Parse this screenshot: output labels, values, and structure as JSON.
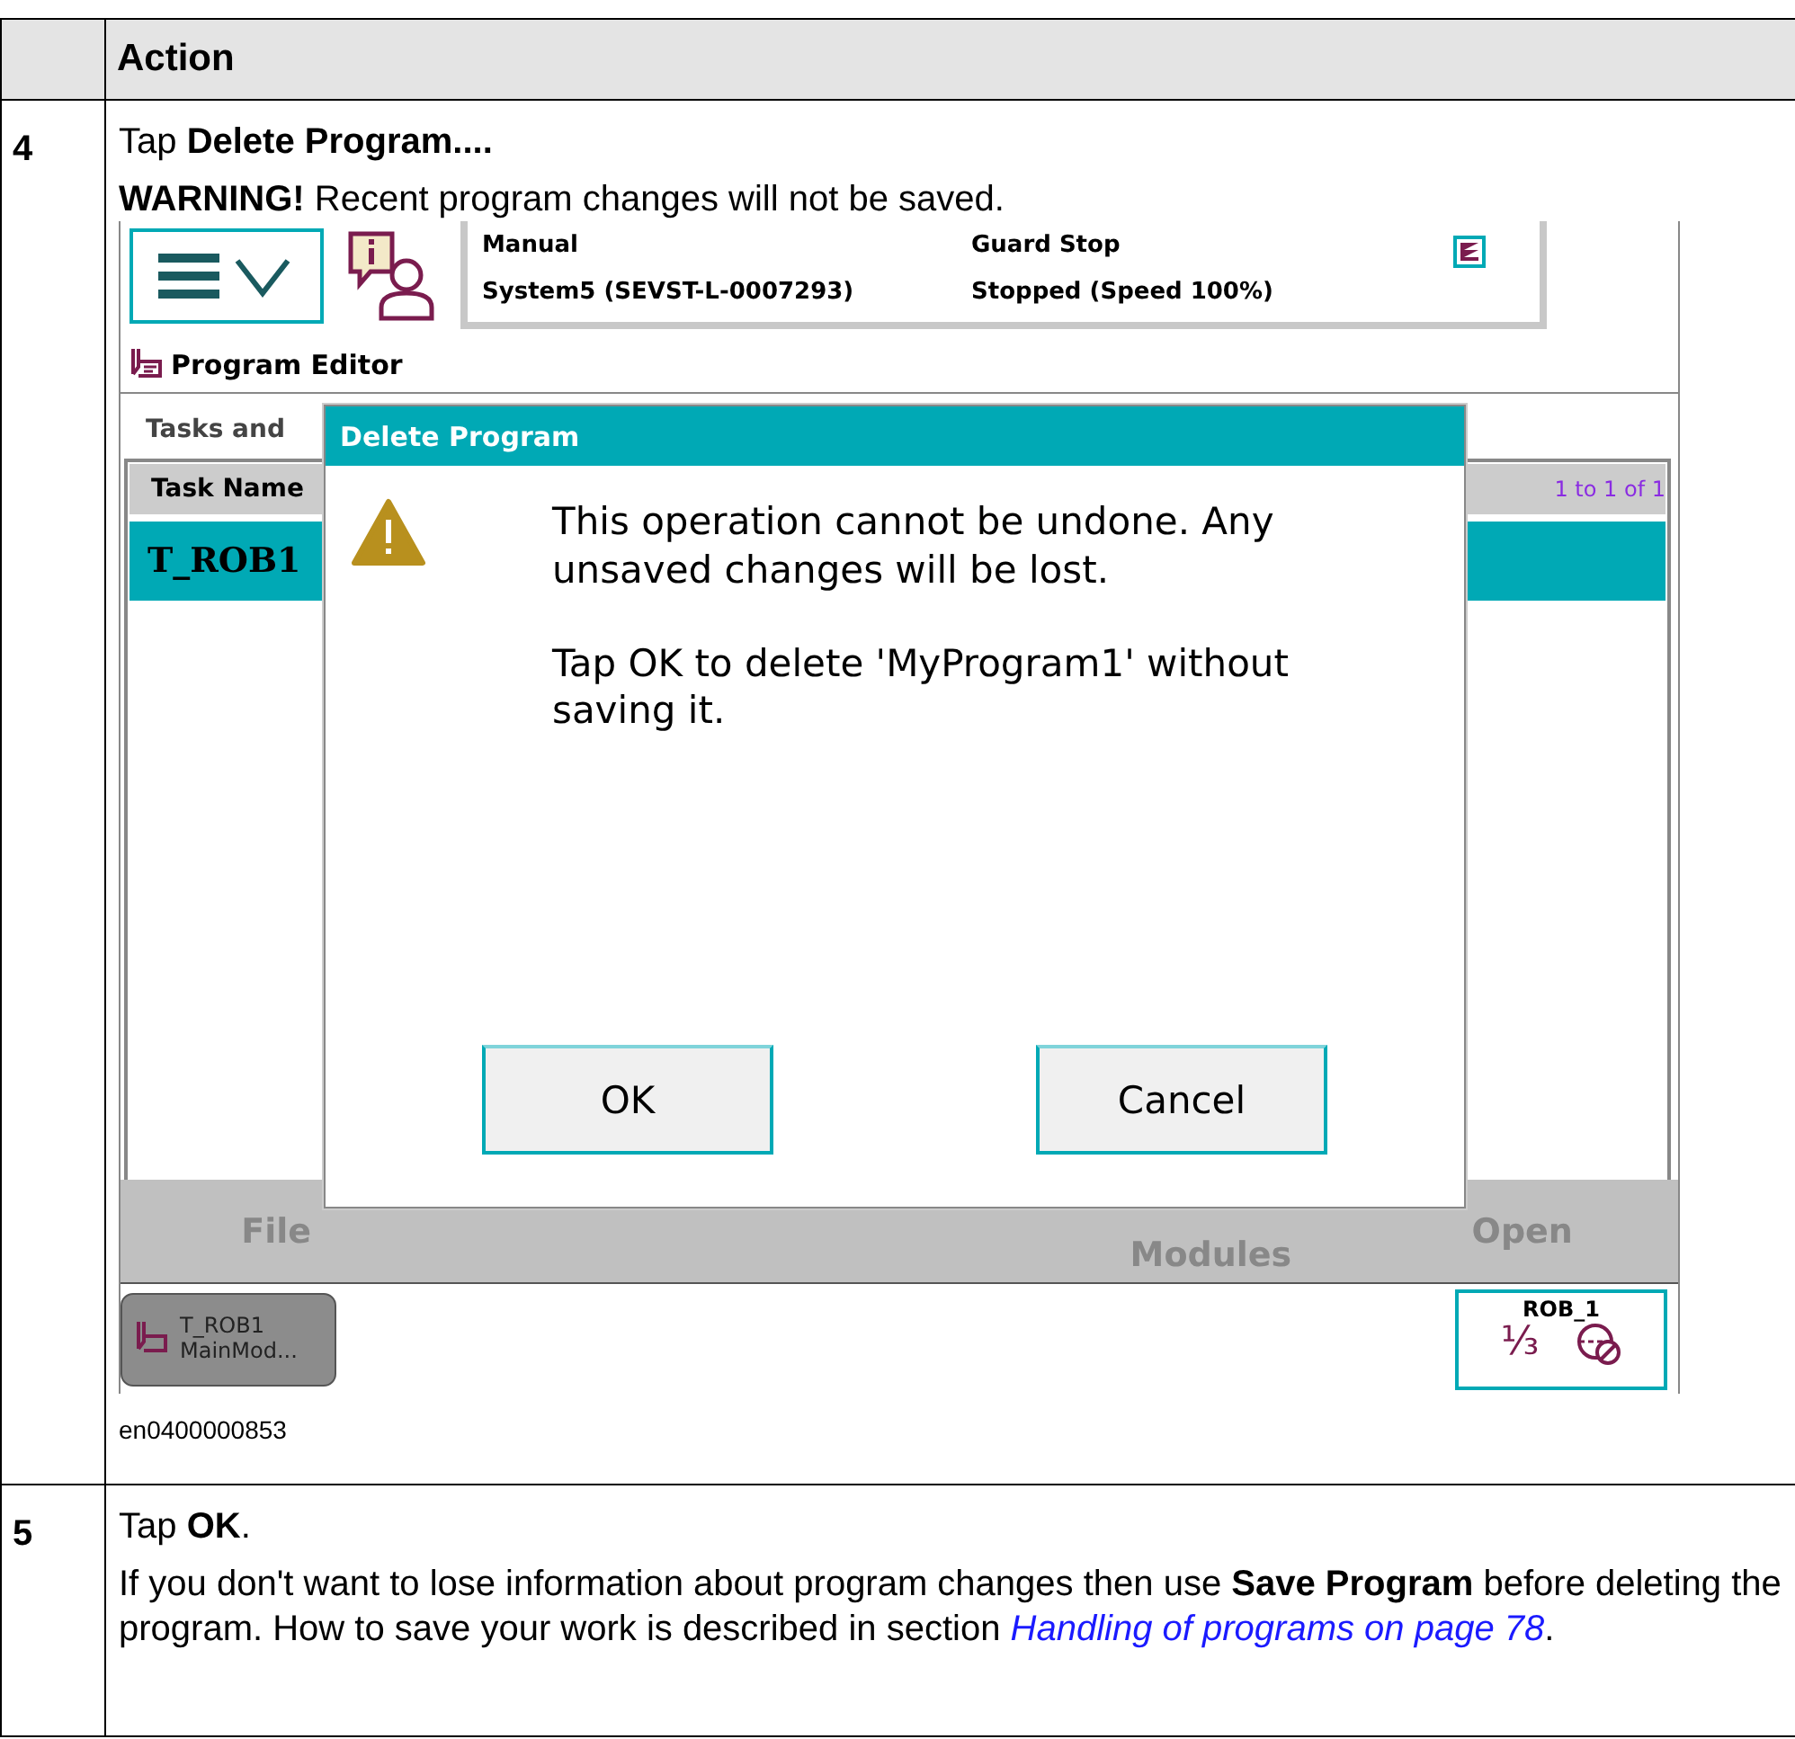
{
  "table": {
    "columns": [
      "Action"
    ],
    "steps": [
      {
        "number": "4",
        "instruction": "Tap **Delete Program....**",
        "note": "**WARNING!** Recent program changes will not be saved.",
        "screen": {
          "status": {
            "mode": "Manual",
            "system": "System5 (SEVST-L-0007293)",
            "state": "Guard Stop",
            "speed": "Stopped (Speed 100%)"
          },
          "app_title": "Program Editor",
          "section_label": "Tasks and",
          "task_table": {
            "columns": [
              "Task Name"
            ],
            "range": "1 to 1 of 1",
            "rows": [
              {
                "cells": [
                  "T_ROB1"
                ],
                "selected": true
              }
            ]
          },
          "toolbar": [
            "File",
            "Modules",
            "Open"
          ],
          "taskbar": [
            {
              "line1": "T_ROB1",
              "line2": "MainMod..."
            }
          ],
          "robot": {
            "name": "ROB_1",
            "speed_fraction": "⅓"
          },
          "dialog": {
            "title": "Delete Program",
            "messages": [
              "This operation cannot be undone. Any unsaved changes will be lost.",
              "Tap OK to delete 'MyProgram1' without saving it."
            ],
            "buttons": [
              "OK",
              "Cancel"
            ]
          }
        },
        "caption": "en0400000853"
      },
      {
        "number": "5",
        "instruction": "Tap **OK**.",
        "note": "If you don't want to lose information about program changes then use **Save Program** before deleting the program. How to save your work is described in section",
        "link": "Handling of programs on page 78",
        "note_end": "."
      }
    ]
  }
}
